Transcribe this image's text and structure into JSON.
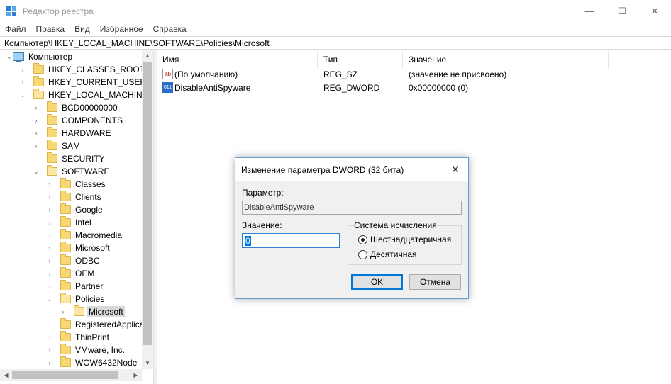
{
  "window": {
    "title": "Редактор реестра",
    "minimize_glyph": "—",
    "maximize_glyph": "☐",
    "close_glyph": "✕"
  },
  "menu": [
    "Файл",
    "Правка",
    "Вид",
    "Избранное",
    "Справка"
  ],
  "address": "Компьютер\\HKEY_LOCAL_MACHINE\\SOFTWARE\\Policies\\Microsoft",
  "tree": [
    {
      "label": "Компьютер",
      "chevron": "⌄",
      "icon": "computer-icon"
    },
    {
      "label": "HKEY_CLASSES_ROOT",
      "chevron": "›"
    },
    {
      "label": "HKEY_CURRENT_USER",
      "chevron": "›"
    },
    {
      "label": "HKEY_LOCAL_MACHINE",
      "chevron": "⌄"
    },
    {
      "label": "BCD00000000",
      "chevron": "›"
    },
    {
      "label": "COMPONENTS",
      "chevron": "›"
    },
    {
      "label": "HARDWARE",
      "chevron": "›"
    },
    {
      "label": "SAM",
      "chevron": "›"
    },
    {
      "label": "SECURITY",
      "chevron": ""
    },
    {
      "label": "SOFTWARE",
      "chevron": "⌄"
    },
    {
      "label": "Classes",
      "chevron": "›"
    },
    {
      "label": "Clients",
      "chevron": "›"
    },
    {
      "label": "Google",
      "chevron": "›"
    },
    {
      "label": "Intel",
      "chevron": "›"
    },
    {
      "label": "Macromedia",
      "chevron": "›"
    },
    {
      "label": "Microsoft",
      "chevron": "›"
    },
    {
      "label": "ODBC",
      "chevron": "›"
    },
    {
      "label": "OEM",
      "chevron": "›"
    },
    {
      "label": "Partner",
      "chevron": "›"
    },
    {
      "label": "Policies",
      "chevron": "⌄"
    },
    {
      "label": "Microsoft",
      "chevron": "›",
      "selected": true
    },
    {
      "label": "RegisteredApplica",
      "chevron": ""
    },
    {
      "label": "ThinPrint",
      "chevron": "›"
    },
    {
      "label": "VMware, Inc.",
      "chevron": "›"
    },
    {
      "label": "WOW6432Node",
      "chevron": "›"
    }
  ],
  "list": {
    "columns": [
      "Имя",
      "Тип",
      "Значение"
    ],
    "rows": [
      {
        "icon": "ab",
        "name": "(По умолчанию)",
        "type": "REG_SZ",
        "value": "(значение не присвоено)"
      },
      {
        "icon": "011",
        "name": "DisableAntiSpyware",
        "type": "REG_DWORD",
        "value": "0x00000000 (0)"
      }
    ]
  },
  "dialog": {
    "title": "Изменение параметра DWORD (32 бита)",
    "close_glyph": "✕",
    "param_label": "Параметр:",
    "param_value": "DisableAntiSpyware",
    "value_label": "Значение:",
    "value": "0",
    "base_legend": "Система исчисления",
    "radio_hex": "Шестнадцатеричная",
    "radio_dec": "Десятичная",
    "ok": "OK",
    "cancel": "Отмена"
  },
  "scroll": {
    "up": "▲",
    "down": "▼",
    "left": "◀",
    "right": "▶"
  },
  "colors": {
    "accent": "#0078d7",
    "folder": "#f8d775",
    "selection": "#d9d9d9"
  }
}
